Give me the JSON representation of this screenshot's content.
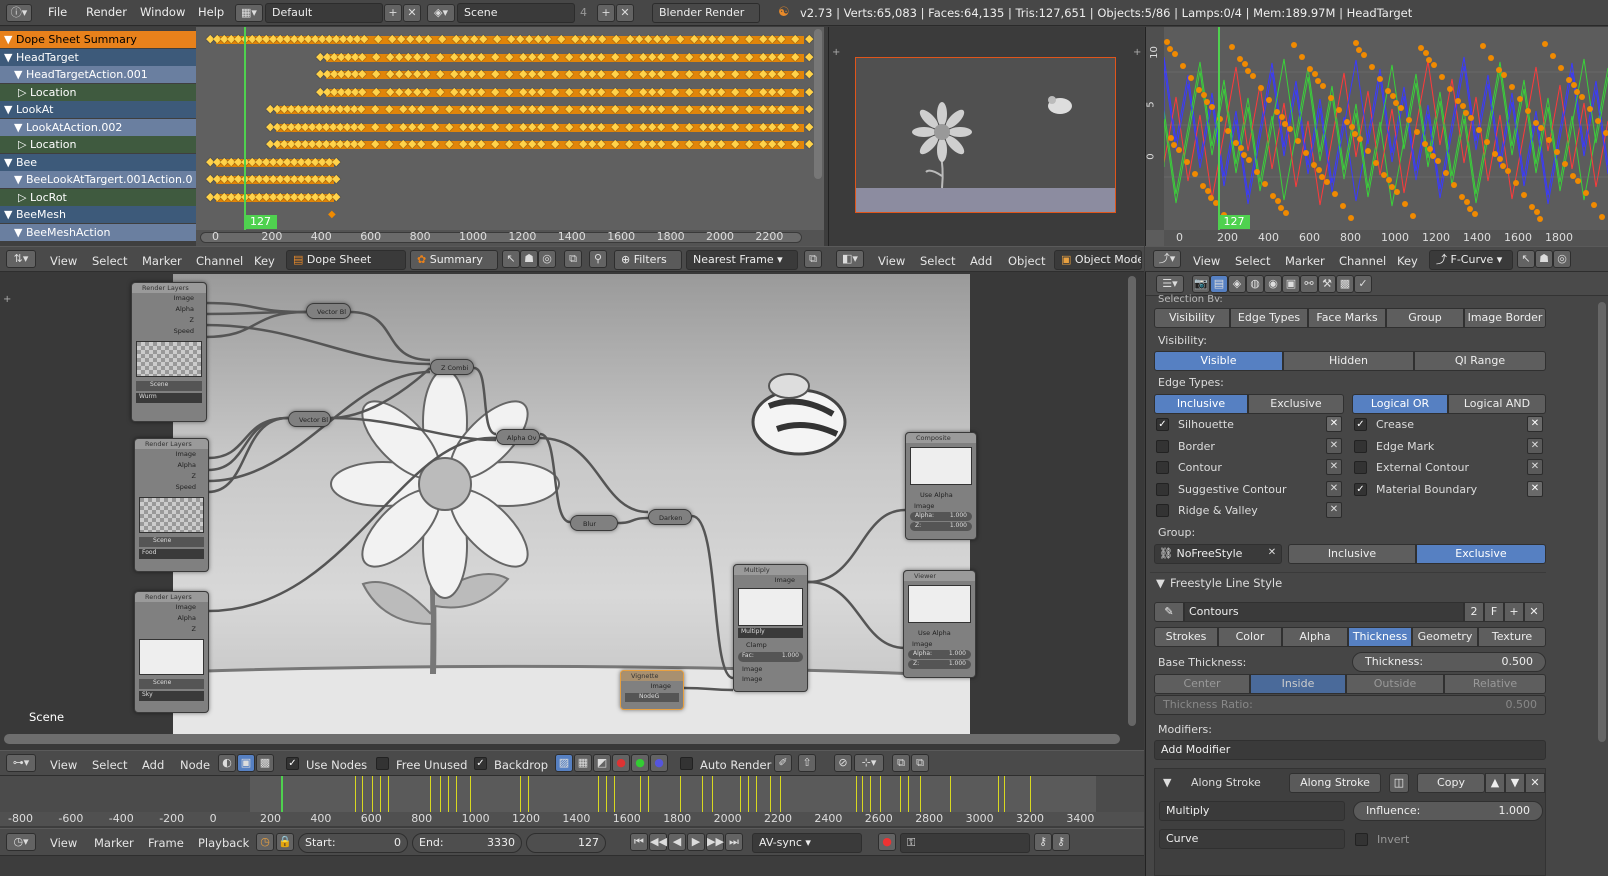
{
  "topbar": {
    "menus": [
      "File",
      "Render",
      "Window",
      "Help"
    ],
    "screen_layout": "Default",
    "scene": "Scene",
    "scene_users": "4",
    "engine": "Blender Render",
    "stats": "v2.73 | Verts:65,083 | Faces:64,135 | Tris:127,651 | Objects:5/86 | Lamps:0/4 | Mem:189.97M | HeadTarget"
  },
  "dopesheet": {
    "channels": [
      {
        "label": "Dope Sheet Summary",
        "kind": "summary"
      },
      {
        "label": "HeadTarget",
        "kind": "object"
      },
      {
        "label": "HeadTargetAction.001",
        "kind": "action"
      },
      {
        "label": "Location",
        "kind": "group"
      },
      {
        "label": "LookAt",
        "kind": "object"
      },
      {
        "label": "LookAtAction.002",
        "kind": "action"
      },
      {
        "label": "Location",
        "kind": "group"
      },
      {
        "label": "Bee",
        "kind": "object"
      },
      {
        "label": "BeeLookAtTargert.001Action.0",
        "kind": "action"
      },
      {
        "label": "LocRot",
        "kind": "group"
      },
      {
        "label": "BeeMesh",
        "kind": "object"
      },
      {
        "label": "BeeMeshAction",
        "kind": "action"
      }
    ],
    "current_frame": "127",
    "ruler": [
      "0",
      "200",
      "400",
      "600",
      "800",
      "1000",
      "1200",
      "1400",
      "1600",
      "1800",
      "2000",
      "2200"
    ],
    "header": {
      "menus": [
        "View",
        "Select",
        "Marker",
        "Channel",
        "Key"
      ],
      "mode": "Dope Sheet",
      "summary": "Summary",
      "filters": "Filters",
      "snap": "Nearest Frame"
    }
  },
  "viewport3d": {
    "menus": [
      "View",
      "Select",
      "Add",
      "Object"
    ],
    "mode": "Object Mode"
  },
  "graph": {
    "ruler": [
      "0",
      "200",
      "400",
      "600",
      "800",
      "1000",
      "1200",
      "1400",
      "1600",
      "1800"
    ],
    "yticks": [
      "10",
      "5",
      "0"
    ],
    "current_frame": "127",
    "header": {
      "menus": [
        "View",
        "Select",
        "Marker",
        "Channel",
        "Key"
      ],
      "mode": "F-Curve"
    }
  },
  "node_editor": {
    "scene_label": "Scene",
    "nodes": {
      "rl1": {
        "title": "Render Layers",
        "outputs": [
          "Image",
          "Alpha",
          "Z",
          "Speed"
        ],
        "scene": "Scene",
        "layer": "Wurm"
      },
      "rl2": {
        "title": "Render Layers",
        "outputs": [
          "Image",
          "Alpha",
          "Z",
          "Speed"
        ],
        "scene": "Scene",
        "layer": "Food"
      },
      "rl3": {
        "title": "Render Layers",
        "outputs": [
          "Image",
          "Alpha",
          "Z"
        ],
        "scene": "Scene",
        "layer": "Sky"
      },
      "vb1": "Vector Bl",
      "vb2": "Vector Bl",
      "zc": "Z Combi",
      "ao": "Alpha Ov",
      "blur": "Blur",
      "darken": "Darken",
      "vignette": {
        "title": "Vignette",
        "out": "Image",
        "group": "NodeG"
      },
      "multiply": {
        "title": "Multiply",
        "out": "Image",
        "mode": "Multiply",
        "clamp": "Clamp",
        "fac_label": "Fac:",
        "fac": "1.000",
        "in1": "Image",
        "in2": "Image"
      },
      "composite": {
        "title": "Composite",
        "use_alpha": "Use Alpha",
        "image": "Image",
        "alpha_label": "Alpha:",
        "alpha": "1.000",
        "z_label": "Z:",
        "z": "1.000"
      },
      "viewer": {
        "title": "Viewer",
        "use_alpha": "Use Alpha",
        "image": "Image",
        "alpha_label": "Alpha:",
        "alpha": "1.000",
        "z_label": "Z:",
        "z": "1.000"
      }
    },
    "header": {
      "menus": [
        "View",
        "Select",
        "Add",
        "Node"
      ],
      "use_nodes": "Use Nodes",
      "free_unused": "Free Unused",
      "backdrop": "Backdrop",
      "auto_render": "Auto Render"
    }
  },
  "properties": {
    "selection_by_partial": "Selection By:",
    "selection_tabs": [
      "Visibility",
      "Edge Types",
      "Face Marks",
      "Group",
      "Image Border"
    ],
    "visibility_label": "Visibility:",
    "visibility_opts": [
      "Visible",
      "Hidden",
      "QI Range"
    ],
    "edge_types_label": "Edge Types:",
    "edge_mode": [
      "Inclusive",
      "Exclusive"
    ],
    "edge_logic": [
      "Logical OR",
      "Logical AND"
    ],
    "edges_left": [
      {
        "label": "Silhouette",
        "checked": true
      },
      {
        "label": "Border",
        "checked": false
      },
      {
        "label": "Contour",
        "checked": false
      },
      {
        "label": "Suggestive Contour",
        "checked": false
      },
      {
        "label": "Ridge & Valley",
        "checked": false
      }
    ],
    "edges_right": [
      {
        "label": "Crease",
        "checked": true
      },
      {
        "label": "Edge Mark",
        "checked": false
      },
      {
        "label": "External Contour",
        "checked": false
      },
      {
        "label": "Material Boundary",
        "checked": true
      }
    ],
    "group_label": "Group:",
    "group_value": "NoFreeStyle",
    "group_mode": [
      "Inclusive",
      "Exclusive"
    ],
    "line_style_panel": "Freestyle Line Style",
    "line_style_name": "Contours",
    "line_style_users": "2",
    "line_style_fake": "F",
    "ls_tabs": [
      "Strokes",
      "Color",
      "Alpha",
      "Thickness",
      "Geometry",
      "Texture"
    ],
    "base_thickness_label": "Base Thickness:",
    "thickness_label": "Thickness:",
    "thickness_value": "0.500",
    "thickness_pos": [
      "Center",
      "Inside",
      "Outside",
      "Relative"
    ],
    "thickness_ratio_label": "Thickness Ratio:",
    "thickness_ratio_value": "0.500",
    "modifiers_label": "Modifiers:",
    "add_modifier": "Add Modifier",
    "modifier_type": "Along Stroke",
    "modifier_name": "Along Stroke",
    "copy_label": "Copy",
    "blend": "Multiply",
    "influence_label": "Influence:",
    "influence_value": "1.000",
    "mapping": "Curve",
    "invert_label": "Invert"
  },
  "timeline": {
    "ruler": [
      "-800",
      "-600",
      "-400",
      "-200",
      "0",
      "200",
      "400",
      "600",
      "800",
      "1000",
      "1200",
      "1400",
      "1600",
      "1800",
      "2000",
      "2200",
      "2400",
      "2600",
      "2800",
      "3000",
      "3200",
      "3400"
    ],
    "header_menus": [
      "View",
      "Marker",
      "Frame",
      "Playback"
    ],
    "start_label": "Start:",
    "start": "0",
    "end_label": "End:",
    "end": "3330",
    "frame": "127",
    "sync": "AV-sync"
  },
  "colors": {
    "selected_blue": "#5680c2",
    "keyframe_orange": "#f08a00",
    "summary_orange": "#e8811b",
    "frame_green": "#4fd14f"
  }
}
